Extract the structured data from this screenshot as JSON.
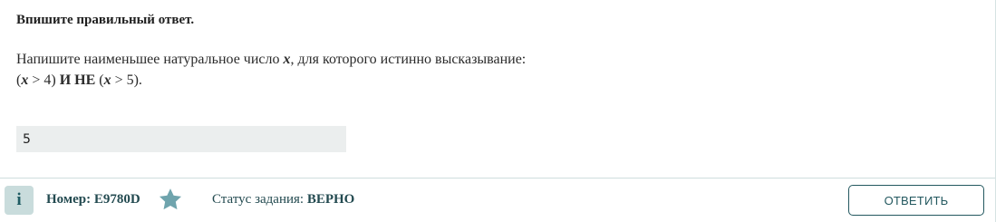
{
  "task": {
    "instruction": "Впишите правильный ответ.",
    "question": {
      "line1_text": "Напишите наименьшее натуральное число ",
      "variable": "x",
      "line1_tail": ", для которого истинно высказывание:",
      "expr_open": "(",
      "expr_var1": "x",
      "expr_cond1": " > 4) ",
      "expr_op": "И НЕ",
      "expr_mid": " (",
      "expr_var2": "x",
      "expr_cond2": " > 5)."
    },
    "answer_value": "5"
  },
  "footer": {
    "info_label": "i",
    "number_label": "Номер: E9780D",
    "status_label": "Статус задания: ",
    "status_value": "ВЕРНО",
    "submit_label": "ОТВЕТИТЬ"
  },
  "colors": {
    "accent": "#23585f",
    "star": "#6fa4ad",
    "input_bg": "#ebeeee"
  }
}
